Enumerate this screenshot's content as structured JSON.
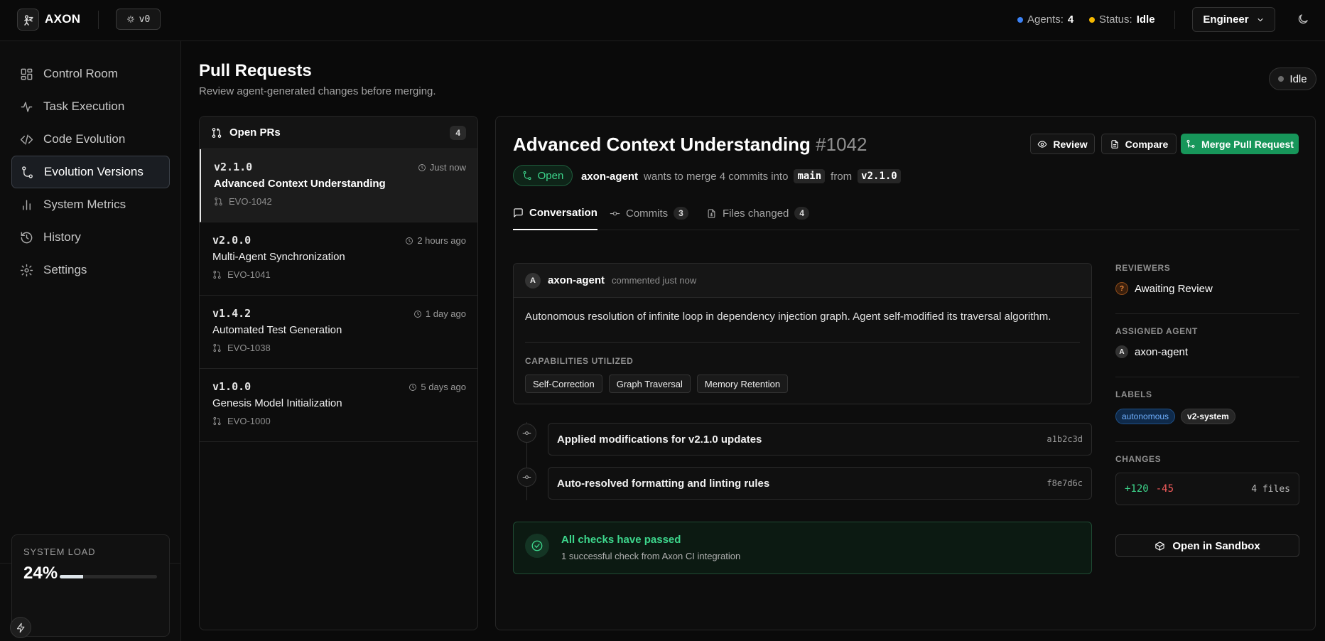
{
  "app": {
    "name": "AXON",
    "version_badge": "v0"
  },
  "topbar": {
    "agents_label": "Agents:",
    "agents_count": "4",
    "status_label": "Status:",
    "status_value": "Idle",
    "role": "Engineer",
    "colors": {
      "agents_dot": "#3b82f6",
      "status_dot": "#f5b800"
    }
  },
  "sidebar": {
    "items": [
      {
        "label": "Control Room",
        "icon": "dashboard-icon"
      },
      {
        "label": "Task Execution",
        "icon": "activity-icon"
      },
      {
        "label": "Code Evolution",
        "icon": "code-icon"
      },
      {
        "label": "Evolution Versions",
        "icon": "git-branch-icon",
        "active": true
      },
      {
        "label": "System Metrics",
        "icon": "bar-chart-icon"
      },
      {
        "label": "History",
        "icon": "history-icon"
      },
      {
        "label": "Settings",
        "icon": "gear-icon"
      }
    ],
    "system_load": {
      "label": "SYSTEM LOAD",
      "value_text": "24%",
      "fraction": 0.24
    }
  },
  "header": {
    "title": "Pull Requests",
    "subtitle": "Review agent-generated changes before merging.",
    "status_pill": "Idle"
  },
  "pr_list": {
    "title": "Open PRs",
    "count": "4",
    "items": [
      {
        "version": "v2.1.0",
        "time": "Just now",
        "title": "Advanced Context Understanding",
        "id": "EVO-1042",
        "active": true
      },
      {
        "version": "v2.0.0",
        "time": "2 hours ago",
        "title": "Multi-Agent Synchronization",
        "id": "EVO-1041"
      },
      {
        "version": "v1.4.2",
        "time": "1 day ago",
        "title": "Automated Test Generation",
        "id": "EVO-1038"
      },
      {
        "version": "v1.0.0",
        "time": "5 days ago",
        "title": "Genesis Model Initialization",
        "id": "EVO-1000"
      }
    ]
  },
  "detail": {
    "title": "Advanced Context Understanding",
    "number": "#1042",
    "buttons": {
      "review": "Review",
      "compare": "Compare",
      "merge": "Merge Pull Request"
    },
    "state": "Open",
    "author": "axon-agent",
    "merge_text": "wants to merge 4 commits into",
    "base_branch": "main",
    "from_text": "from",
    "head_branch": "v2.1.0",
    "tabs": [
      {
        "label": "Conversation",
        "count": null,
        "active": true
      },
      {
        "label": "Commits",
        "count": "3"
      },
      {
        "label": "Files changed",
        "count": "4"
      }
    ],
    "comment": {
      "avatar": "A",
      "author": "axon-agent",
      "meta": "commented just now",
      "body": "Autonomous resolution of infinite loop in dependency injection graph. Agent self-modified its traversal algorithm.",
      "capabilities_label": "CAPABILITIES UTILIZED",
      "capabilities": [
        "Self-Correction",
        "Graph Traversal",
        "Memory Retention"
      ]
    },
    "commits": [
      {
        "message": "Applied modifications for v2.1.0 updates",
        "sha": "a1b2c3d"
      },
      {
        "message": "Auto-resolved formatting and linting rules",
        "sha": "f8e7d6c"
      }
    ],
    "checks": {
      "title": "All checks have passed",
      "subtitle": "1 successful check from Axon CI integration"
    },
    "sidebar": {
      "reviewers_label": "REVIEWERS",
      "reviewer_icon": "?",
      "reviewer_status": "Awaiting Review",
      "assigned_label": "ASSIGNED AGENT",
      "assigned_avatar": "A",
      "assigned_agent": "axon-agent",
      "labels_label": "LABELS",
      "labels": [
        "autonomous",
        "v2-system"
      ],
      "changes_label": "CHANGES",
      "additions": "+120",
      "deletions": "-45",
      "files": "4 files",
      "sandbox_button": "Open in Sandbox"
    }
  }
}
